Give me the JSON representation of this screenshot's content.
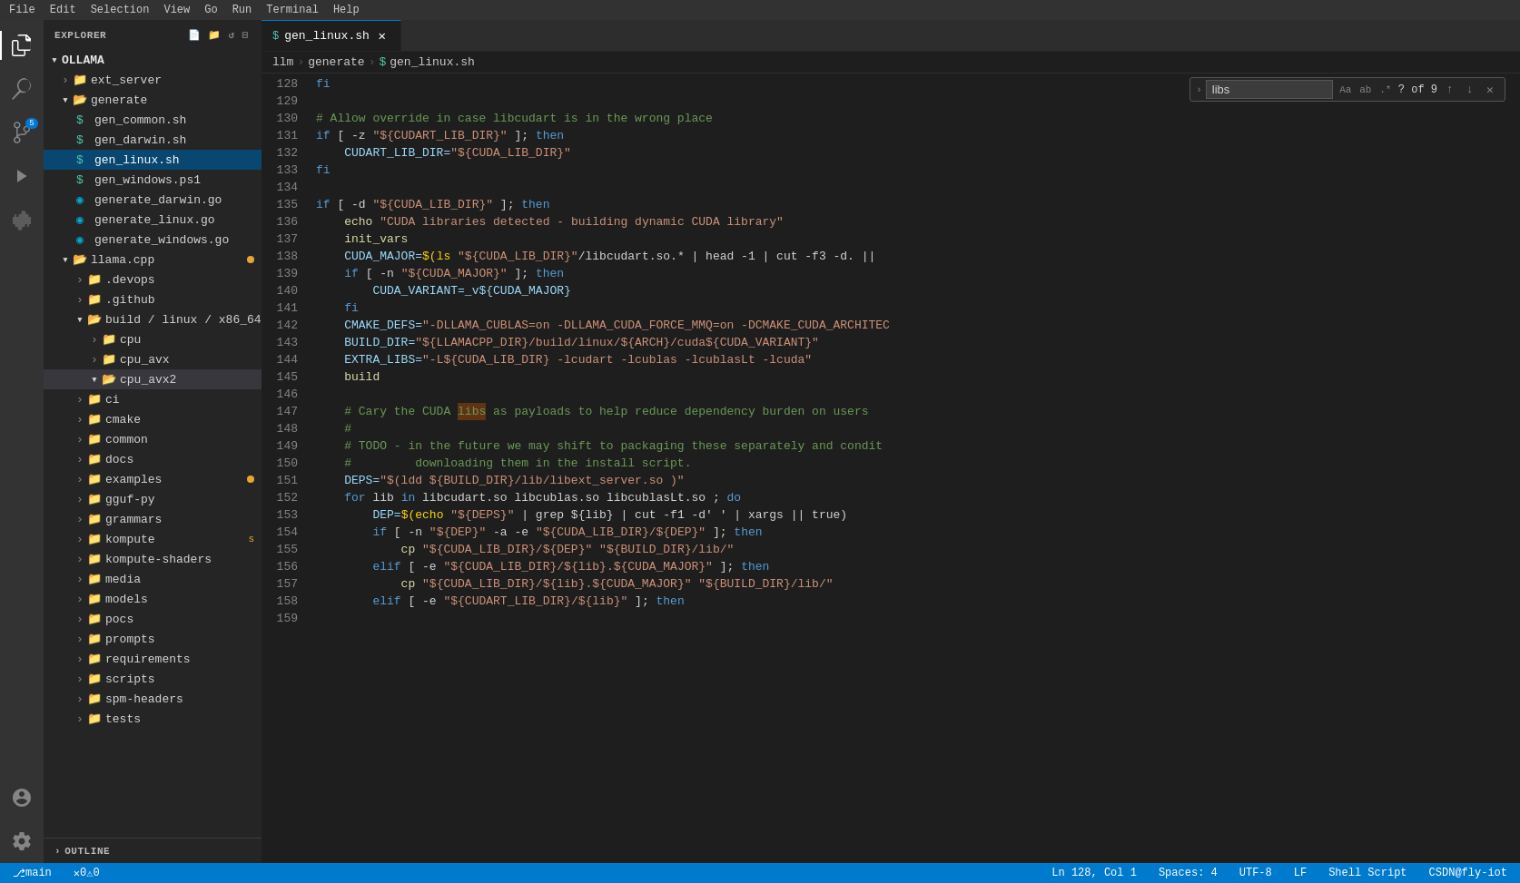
{
  "titlebar": {
    "menus": [
      "File",
      "Edit",
      "Selection",
      "View",
      "Go",
      "Run",
      "Terminal",
      "Help"
    ]
  },
  "sidebar": {
    "title": "EXPLORER",
    "root": "OLLAMA",
    "items": [
      {
        "id": "ext_server",
        "label": "ext_server",
        "indent": 1,
        "type": "folder",
        "collapsed": true
      },
      {
        "id": "generate",
        "label": "generate",
        "indent": 1,
        "type": "folder",
        "collapsed": false
      },
      {
        "id": "gen_common",
        "label": "gen_common.sh",
        "indent": 2,
        "type": "file-sh"
      },
      {
        "id": "gen_darwin",
        "label": "gen_darwin.sh",
        "indent": 2,
        "type": "file-sh"
      },
      {
        "id": "gen_linux",
        "label": "gen_linux.sh",
        "indent": 2,
        "type": "file-sh",
        "active": true
      },
      {
        "id": "gen_windows",
        "label": "gen_windows.ps1",
        "indent": 2,
        "type": "file-sh"
      },
      {
        "id": "gen_darwin_go",
        "label": "generate_darwin.go",
        "indent": 2,
        "type": "file-go"
      },
      {
        "id": "gen_linux_go",
        "label": "generate_linux.go",
        "indent": 2,
        "type": "file-go"
      },
      {
        "id": "gen_windows_go",
        "label": "generate_windows.go",
        "indent": 2,
        "type": "file-go"
      },
      {
        "id": "llama_cpp",
        "label": "llama.cpp",
        "indent": 1,
        "type": "folder",
        "collapsed": false,
        "modified": true
      },
      {
        "id": "devops",
        "label": ".devops",
        "indent": 2,
        "type": "folder",
        "collapsed": true
      },
      {
        "id": "github",
        "label": ".github",
        "indent": 2,
        "type": "folder",
        "collapsed": true
      },
      {
        "id": "build_linux",
        "label": "build / linux / x86_64",
        "indent": 2,
        "type": "folder",
        "collapsed": false
      },
      {
        "id": "cpu",
        "label": "cpu",
        "indent": 3,
        "type": "folder",
        "collapsed": true
      },
      {
        "id": "cpu_avx",
        "label": "cpu_avx",
        "indent": 3,
        "type": "folder",
        "collapsed": true
      },
      {
        "id": "cpu_avx2",
        "label": "cpu_avx2",
        "indent": 3,
        "type": "folder",
        "collapsed": false,
        "selected": true
      },
      {
        "id": "ci",
        "label": "ci",
        "indent": 2,
        "type": "folder",
        "collapsed": true
      },
      {
        "id": "cmake",
        "label": "cmake",
        "indent": 2,
        "type": "folder",
        "collapsed": true
      },
      {
        "id": "common",
        "label": "common",
        "indent": 2,
        "type": "folder",
        "collapsed": true
      },
      {
        "id": "docs",
        "label": "docs",
        "indent": 2,
        "type": "folder",
        "collapsed": true
      },
      {
        "id": "examples",
        "label": "examples",
        "indent": 2,
        "type": "folder",
        "collapsed": true,
        "modified": true
      },
      {
        "id": "gguf_py",
        "label": "gguf-py",
        "indent": 2,
        "type": "folder",
        "collapsed": true
      },
      {
        "id": "grammars",
        "label": "grammars",
        "indent": 2,
        "type": "folder",
        "collapsed": true
      },
      {
        "id": "kompute",
        "label": "kompute",
        "indent": 2,
        "type": "folder",
        "collapsed": true,
        "staged": "s"
      },
      {
        "id": "kompute_shaders",
        "label": "kompute-shaders",
        "indent": 2,
        "type": "folder",
        "collapsed": true
      },
      {
        "id": "media",
        "label": "media",
        "indent": 2,
        "type": "folder",
        "collapsed": true
      },
      {
        "id": "models",
        "label": "models",
        "indent": 2,
        "type": "folder",
        "collapsed": true
      },
      {
        "id": "pocs",
        "label": "pocs",
        "indent": 2,
        "type": "folder",
        "collapsed": true
      },
      {
        "id": "prompts",
        "label": "prompts",
        "indent": 2,
        "type": "folder",
        "collapsed": true
      },
      {
        "id": "requirements",
        "label": "requirements",
        "indent": 2,
        "type": "folder",
        "collapsed": true
      },
      {
        "id": "scripts",
        "label": "scripts",
        "indent": 2,
        "type": "folder",
        "collapsed": true
      },
      {
        "id": "spm_headers",
        "label": "spm-headers",
        "indent": 2,
        "type": "folder",
        "collapsed": true
      },
      {
        "id": "tests",
        "label": "tests",
        "indent": 2,
        "type": "folder",
        "collapsed": true
      }
    ],
    "outline": "OUTLINE"
  },
  "tab": {
    "filename": "gen_linux.sh",
    "icon": "$"
  },
  "breadcrumb": {
    "parts": [
      "llm",
      "generate",
      "$ gen_linux.sh"
    ]
  },
  "search": {
    "value": "libs",
    "count": "? of 9",
    "case_label": "Aa",
    "word_label": "ab",
    "regex_label": ".*"
  },
  "lines": [
    {
      "num": 128,
      "tokens": [
        {
          "t": "fi",
          "c": "sh-keyword"
        }
      ]
    },
    {
      "num": 129,
      "tokens": []
    },
    {
      "num": 130,
      "tokens": [
        {
          "t": "# Allow override in case libcudart is in the wrong place",
          "c": "sh-comment"
        }
      ]
    },
    {
      "num": 131,
      "tokens": [
        {
          "t": "if",
          "c": "sh-keyword"
        },
        {
          "t": " [ -z ",
          "c": ""
        },
        {
          "t": "\"${CUDART_LIB_DIR}\"",
          "c": "sh-string"
        },
        {
          "t": " ]; ",
          "c": ""
        },
        {
          "t": "then",
          "c": "sh-keyword"
        }
      ]
    },
    {
      "num": 132,
      "tokens": [
        {
          "t": "    CUDART_LIB_DIR=",
          "c": "sh-var"
        },
        {
          "t": "\"${CUDA_LIB_DIR}\"",
          "c": "sh-string"
        }
      ]
    },
    {
      "num": 133,
      "tokens": [
        {
          "t": "fi",
          "c": "sh-keyword"
        }
      ]
    },
    {
      "num": 134,
      "tokens": []
    },
    {
      "num": 135,
      "tokens": [
        {
          "t": "if",
          "c": "sh-keyword"
        },
        {
          "t": " [ -d ",
          "c": ""
        },
        {
          "t": "\"${CUDA_LIB_DIR}\"",
          "c": "sh-string"
        },
        {
          "t": " ]; ",
          "c": ""
        },
        {
          "t": "then",
          "c": "sh-keyword"
        }
      ]
    },
    {
      "num": 136,
      "tokens": [
        {
          "t": "    ",
          "c": ""
        },
        {
          "t": "echo",
          "c": "sh-func"
        },
        {
          "t": " ",
          "c": ""
        },
        {
          "t": "\"CUDA libraries detected - building dynamic CUDA library\"",
          "c": "sh-string"
        }
      ]
    },
    {
      "num": 137,
      "tokens": [
        {
          "t": "    init_vars",
          "c": "sh-func"
        }
      ]
    },
    {
      "num": 138,
      "tokens": [
        {
          "t": "    CUDA_MAJOR=",
          "c": "sh-var"
        },
        {
          "t": "$(ls ",
          "c": "sh-bracket"
        },
        {
          "t": "\"${CUDA_LIB_DIR}\"",
          "c": "sh-string"
        },
        {
          "t": "/libcudart.so.* | head -1 | cut -f3 -d. ||",
          "c": ""
        }
      ]
    },
    {
      "num": 139,
      "tokens": [
        {
          "t": "    ",
          "c": ""
        },
        {
          "t": "if",
          "c": "sh-keyword"
        },
        {
          "t": " [ -n ",
          "c": ""
        },
        {
          "t": "\"${CUDA_MAJOR}\"",
          "c": "sh-string"
        },
        {
          "t": " ]; ",
          "c": ""
        },
        {
          "t": "then",
          "c": "sh-keyword"
        }
      ]
    },
    {
      "num": 140,
      "tokens": [
        {
          "t": "        CUDA_VARIANT=",
          "c": "sh-var"
        },
        {
          "t": "_v${CUDA_MAJOR}",
          "c": "sh-var"
        }
      ]
    },
    {
      "num": 141,
      "tokens": [
        {
          "t": "    fi",
          "c": "sh-keyword"
        }
      ]
    },
    {
      "num": 142,
      "tokens": [
        {
          "t": "    CMAKE_DEFS=",
          "c": "sh-var"
        },
        {
          "t": "\"-DLLAMA_CUBLAS=on -DLLAMA_CUDA_FORCE_MMQ=on -DCMAKE_CUDA_ARCHITEC",
          "c": "sh-string"
        }
      ]
    },
    {
      "num": 143,
      "tokens": [
        {
          "t": "    BUILD_DIR=",
          "c": "sh-var"
        },
        {
          "t": "\"${LLAMACPP_DIR}/build/linux/${ARCH}/cuda${CUDA_VARIANT}\"",
          "c": "sh-string"
        }
      ]
    },
    {
      "num": 144,
      "tokens": [
        {
          "t": "    EXTRA_LIBS=",
          "c": "sh-var"
        },
        {
          "t": "\"-L${CUDA_LIB_DIR} -lcudart -lcublas -lcublasLt -lcuda\"",
          "c": "sh-string"
        }
      ]
    },
    {
      "num": 145,
      "tokens": [
        {
          "t": "    build",
          "c": "sh-func"
        }
      ]
    },
    {
      "num": 146,
      "tokens": []
    },
    {
      "num": 147,
      "tokens": [
        {
          "t": "    # Cary the CUDA ",
          "c": "sh-comment"
        },
        {
          "t": "libs",
          "c": "sh-highlight sh-comment"
        },
        {
          "t": " as payloads to help reduce dependency burden on users",
          "c": "sh-comment"
        }
      ]
    },
    {
      "num": 148,
      "tokens": [
        {
          "t": "    #",
          "c": "sh-comment"
        }
      ]
    },
    {
      "num": 149,
      "tokens": [
        {
          "t": "    # TODO - in the future we may shift to packaging these separately and condit",
          "c": "sh-comment"
        }
      ]
    },
    {
      "num": 150,
      "tokens": [
        {
          "t": "    #         downloading them in the install script.",
          "c": "sh-comment"
        }
      ]
    },
    {
      "num": 151,
      "tokens": [
        {
          "t": "    DEPS=",
          "c": "sh-var"
        },
        {
          "t": "\"$(ldd ${BUILD_DIR}/lib/libext_server.so )\"",
          "c": "sh-string"
        }
      ]
    },
    {
      "num": 152,
      "tokens": [
        {
          "t": "    ",
          "c": ""
        },
        {
          "t": "for",
          "c": "sh-keyword"
        },
        {
          "t": " lib ",
          "c": ""
        },
        {
          "t": "in",
          "c": "sh-keyword"
        },
        {
          "t": " libcudart.so libcublas.so libcublasLt.so ; ",
          "c": ""
        },
        {
          "t": "do",
          "c": "sh-keyword"
        }
      ]
    },
    {
      "num": 153,
      "tokens": [
        {
          "t": "        DEP=",
          "c": "sh-var"
        },
        {
          "t": "$(echo ",
          "c": "sh-bracket"
        },
        {
          "t": "\"${DEPS}\"",
          "c": "sh-string"
        },
        {
          "t": " | grep ${lib} | cut -f1 -d' ' | xargs || true)",
          "c": ""
        }
      ]
    },
    {
      "num": 154,
      "tokens": [
        {
          "t": "        ",
          "c": ""
        },
        {
          "t": "if",
          "c": "sh-keyword"
        },
        {
          "t": " [ -n ",
          "c": ""
        },
        {
          "t": "\"${DEP}\"",
          "c": "sh-string"
        },
        {
          "t": " -a -e ",
          "c": ""
        },
        {
          "t": "\"${CUDA_LIB_DIR}/${DEP}\"",
          "c": "sh-string"
        },
        {
          "t": " ]; ",
          "c": ""
        },
        {
          "t": "then",
          "c": "sh-keyword"
        }
      ]
    },
    {
      "num": 155,
      "tokens": [
        {
          "t": "            cp ",
          "c": "sh-func"
        },
        {
          "t": "\"${CUDA_LIB_DIR}/${DEP}\"",
          "c": "sh-string"
        },
        {
          "t": " ",
          "c": ""
        },
        {
          "t": "\"${BUILD_DIR}/lib/\"",
          "c": "sh-string"
        }
      ]
    },
    {
      "num": 156,
      "tokens": [
        {
          "t": "        ",
          "c": ""
        },
        {
          "t": "elif",
          "c": "sh-keyword"
        },
        {
          "t": " [ -e ",
          "c": ""
        },
        {
          "t": "\"${CUDA_LIB_DIR}/${lib}.${CUDA_MAJOR}\"",
          "c": "sh-string"
        },
        {
          "t": " ]; ",
          "c": ""
        },
        {
          "t": "then",
          "c": "sh-keyword"
        }
      ]
    },
    {
      "num": 157,
      "tokens": [
        {
          "t": "            cp ",
          "c": "sh-func"
        },
        {
          "t": "\"${CUDA_LIB_DIR}/${lib}.${CUDA_MAJOR}\"",
          "c": "sh-string"
        },
        {
          "t": " ",
          "c": ""
        },
        {
          "t": "\"${BUILD_DIR}/lib/\"",
          "c": "sh-string"
        }
      ]
    },
    {
      "num": 158,
      "tokens": [
        {
          "t": "        ",
          "c": ""
        },
        {
          "t": "elif",
          "c": "sh-keyword"
        },
        {
          "t": " [ -e ",
          "c": ""
        },
        {
          "t": "\"${CUDART_LIB_DIR}/${lib}\"",
          "c": "sh-string"
        },
        {
          "t": " ]; ",
          "c": ""
        },
        {
          "t": "then",
          "c": "sh-keyword"
        }
      ]
    },
    {
      "num": 159,
      "tokens": []
    }
  ],
  "status": {
    "git": "main",
    "errors": "0",
    "warnings": "0",
    "line": "Ln 128, Col 1",
    "spaces": "Spaces: 4",
    "encoding": "UTF-8",
    "eol": "LF",
    "lang": "Shell Script",
    "feedback": "CSDN@fly-iot"
  }
}
